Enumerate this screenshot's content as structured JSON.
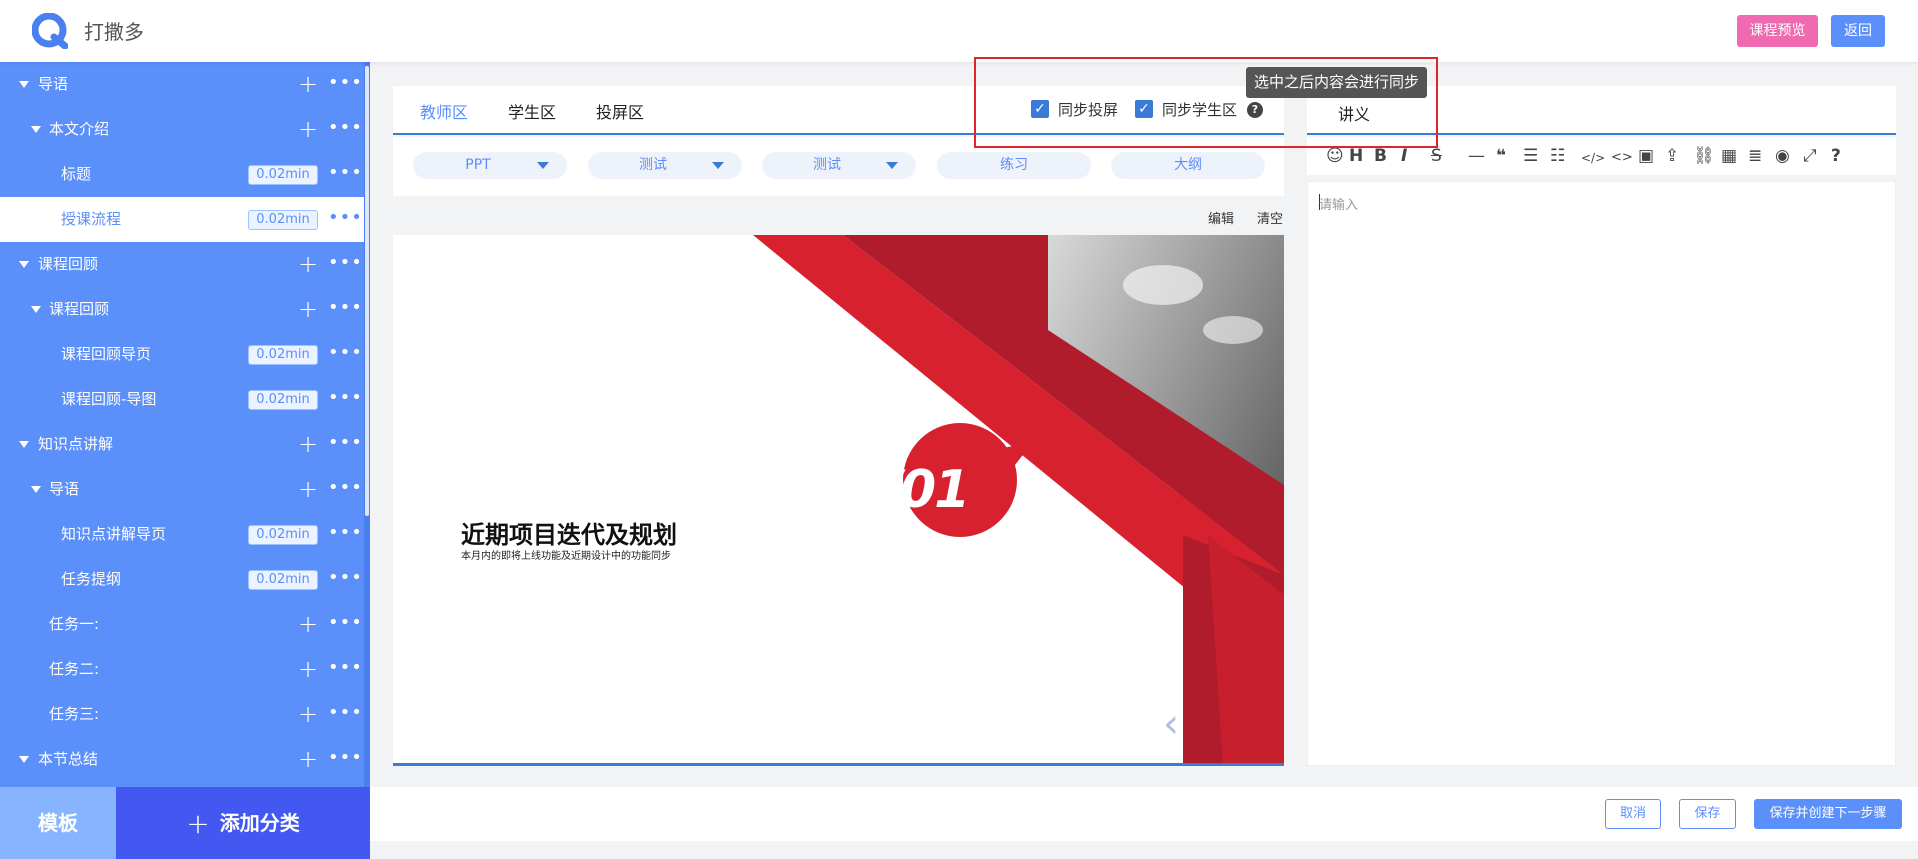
{
  "header": {
    "app_name": "打撒多",
    "preview_label": "课程预览",
    "back_label": "返回"
  },
  "sidebar": {
    "items": [
      {
        "label": "导语",
        "level": 0,
        "badge": null
      },
      {
        "label": "本文介绍",
        "level": 1,
        "badge": null
      },
      {
        "label": "标题",
        "level": 2,
        "badge": "0.02min"
      },
      {
        "label": "授课流程",
        "level": 2,
        "badge": "0.02min",
        "active": true
      },
      {
        "label": "课程回顾",
        "level": 0,
        "badge": null
      },
      {
        "label": "课程回顾",
        "level": 1,
        "badge": null
      },
      {
        "label": "课程回顾导页",
        "level": 2,
        "badge": "0.02min"
      },
      {
        "label": "课程回顾-导图",
        "level": 2,
        "badge": "0.02min"
      },
      {
        "label": "知识点讲解",
        "level": 0,
        "badge": null
      },
      {
        "label": "导语",
        "level": 1,
        "badge": null
      },
      {
        "label": "知识点讲解导页",
        "level": 2,
        "badge": "0.02min"
      },
      {
        "label": "任务提纲",
        "level": 2,
        "badge": "0.02min"
      },
      {
        "label": "任务一:",
        "level": 1,
        "badge": null,
        "no_caret": true
      },
      {
        "label": "任务二:",
        "level": 1,
        "badge": null,
        "no_caret": true
      },
      {
        "label": "任务三:",
        "level": 1,
        "badge": null,
        "no_caret": true
      },
      {
        "label": "本节总结",
        "level": 0,
        "badge": null
      }
    ],
    "template_label": "模板",
    "add_category_label": "添加分类"
  },
  "center": {
    "tabs": [
      "教师区",
      "学生区",
      "投屏区"
    ],
    "active_tab": 0,
    "sync_screen_label": "同步投屏",
    "sync_student_label": "同步学生区",
    "filters": [
      "PPT",
      "测试",
      "测试",
      "练习",
      "大纲"
    ],
    "edit_label": "编辑",
    "clear_label": "清空",
    "slide": {
      "number": "/01",
      "title": "近期项目迭代及规划",
      "subtitle": "本月内的即将上线功能及近期设计中的功能同步"
    }
  },
  "tooltip": "选中之后内容会进行同步",
  "editor": {
    "title": "讲义",
    "placeholder": "请输入",
    "tools": [
      "emoji-icon",
      "heading-icon",
      "bold-icon",
      "italic-icon",
      "strikethrough-icon",
      "hr-icon",
      "quote-icon",
      "ul-icon",
      "ol-icon",
      "code-inline-icon",
      "code-block-icon",
      "image-icon",
      "upload-icon",
      "link-icon",
      "table-icon",
      "toc-icon",
      "preview-icon",
      "fullscreen-icon",
      "help-icon"
    ]
  },
  "footer": {
    "cancel_label": "取消",
    "save_label": "保存",
    "save_next_label": "保存并创建下一步骤"
  },
  "colors": {
    "primary": "#5b8ff9",
    "sidebar": "#5b8ff9",
    "accent_pink": "#f06ab2",
    "add_category": "#4258f0",
    "highlight_red": "#e0242b"
  }
}
